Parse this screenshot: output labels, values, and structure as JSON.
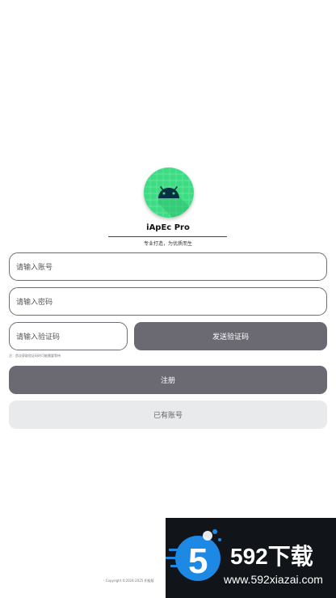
{
  "app": {
    "name": "iApEc Pro",
    "slogan": "专业打造，为优质而生",
    "icon": "android-icon",
    "icon_color": "#3ddc84"
  },
  "form": {
    "account_placeholder": "请输入账号",
    "password_placeholder": "请输入密码",
    "code_placeholder": "请输入验证码",
    "send_code_label": "发送验证码",
    "hint": "注：首次获取验证码时可能需要等待",
    "register_label": "注册",
    "login_label": "已有账号"
  },
  "footer": {
    "copyright": "- Copyright ©2024-2025 积极版"
  },
  "watermark": {
    "brand": "592下载",
    "url": "www.592xiazai.com",
    "accent": "#1e88e5"
  },
  "colors": {
    "primary_button": "#6b6a72",
    "secondary_button": "#e9eaeb",
    "border": "#6e6d75"
  }
}
